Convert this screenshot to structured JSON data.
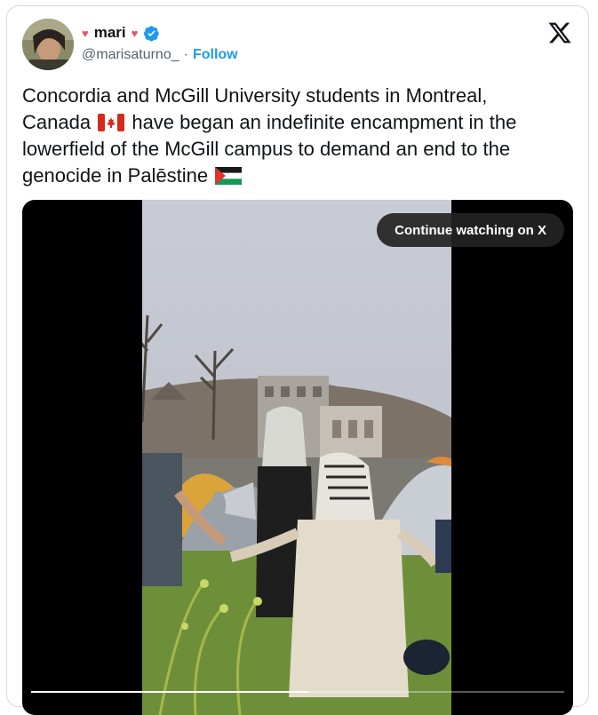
{
  "author": {
    "display_name": "mari",
    "decor_left": "♥",
    "decor_right": "♥",
    "handle": "@marisaturno_",
    "separator": "·",
    "follow_label": "Follow",
    "verified": true
  },
  "brand_icon": "x-logo-icon",
  "tweet": {
    "line1": "Concordia and McGill University students in Montreal,",
    "line2_before_flag": "Canada",
    "line2_after_flag": "have began an indefinite encampment in the",
    "line3": "lowerfield of the McGill campus to demand an end to the",
    "line4_before_flag": "genocide in Palēstine",
    "flags": [
      "canada-flag",
      "palestine-flag"
    ]
  },
  "media": {
    "continue_label": "Continue watching on X",
    "progress": 0.52
  },
  "colors": {
    "accent": "#1d9bf0",
    "text": "#0f1419",
    "muted": "#536471",
    "border": "#cfd9de",
    "heart": "#e0566b"
  }
}
